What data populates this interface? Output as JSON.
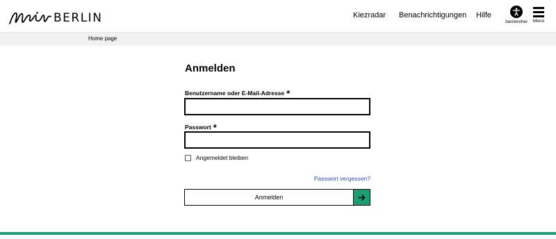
{
  "brand": {
    "logo_text": "BERLIN",
    "logo_script": "mein"
  },
  "nav": {
    "kiezradar": "Kiezradar",
    "notifications": "Benachrichtigungen",
    "help": "Hilfe",
    "accessibility_label": "barrierefrei",
    "menu_label": "Menü"
  },
  "breadcrumb": {
    "home": "Home page"
  },
  "login": {
    "title": "Anmelden",
    "username_label": "Benutzername oder E-Mail-Adresse",
    "username_value": "",
    "password_label": "Passwort",
    "password_value": "",
    "required_marker": "*",
    "remember_label": "Angemeldet bleiben",
    "remember_checked": false,
    "forgot_link": "Passwort vergessen?",
    "submit_label": "Anmelden"
  },
  "colors": {
    "accent": "#1a9e73",
    "link": "#2553b0",
    "breadcrumb_bg": "#f1f1f1"
  },
  "icons": {
    "accessibility": "accessibility-icon",
    "menu": "hamburger-menu-icon",
    "submit": "arrow-right-icon"
  }
}
